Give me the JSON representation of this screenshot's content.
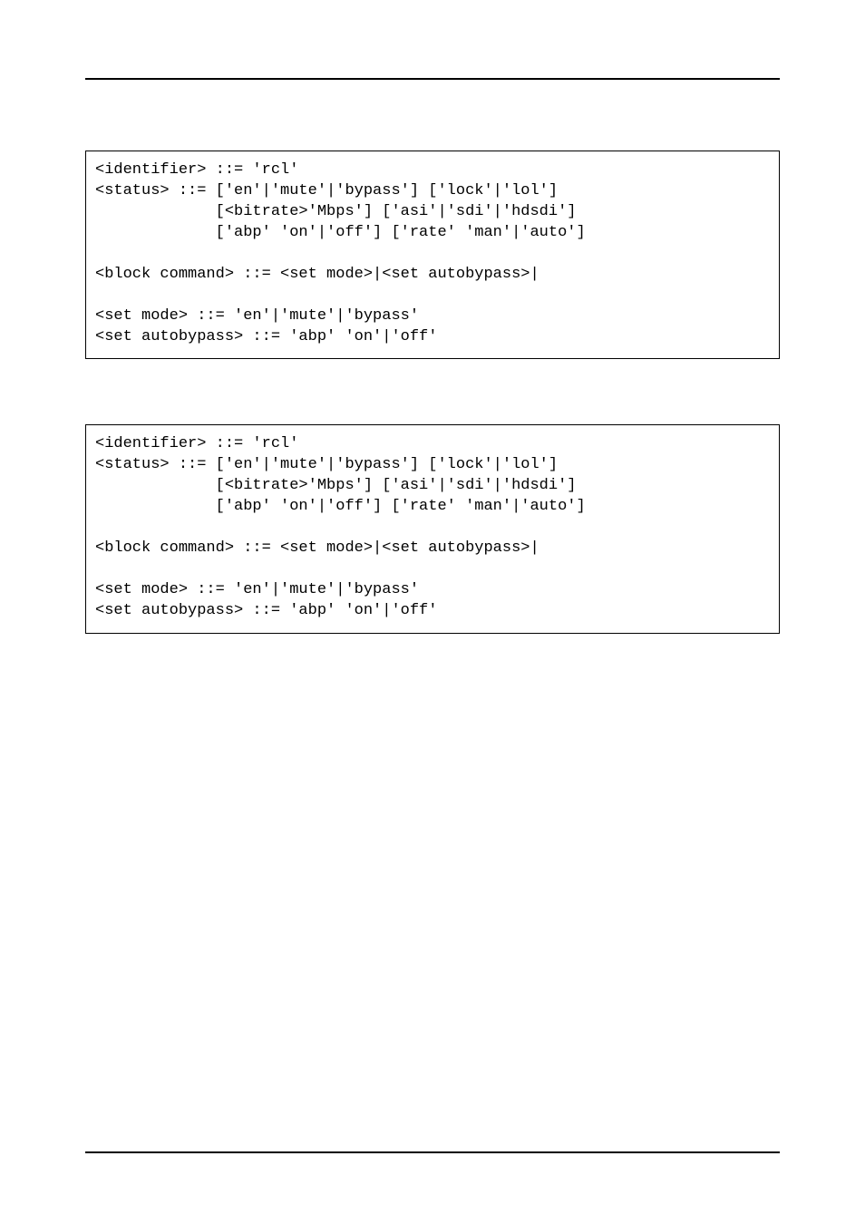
{
  "blocks": [
    {
      "lines": [
        "<identifier> ::= 'rcl'",
        "<status> ::= ['en'|'mute'|'bypass'] ['lock'|'lol']",
        "             [<bitrate>'Mbps'] ['asi'|'sdi'|'hdsdi']",
        "             ['abp' 'on'|'off'] ['rate' 'man'|'auto']",
        "",
        "<block command> ::= <set mode>|<set autobypass>|",
        "",
        "<set mode> ::= 'en'|'mute'|'bypass'",
        "<set autobypass> ::= 'abp' 'on'|'off'"
      ]
    },
    {
      "lines": [
        "<identifier> ::= 'rcl'",
        "<status> ::= ['en'|'mute'|'bypass'] ['lock'|'lol']",
        "             [<bitrate>'Mbps'] ['asi'|'sdi'|'hdsdi']",
        "             ['abp' 'on'|'off'] ['rate' 'man'|'auto']",
        "",
        "<block command> ::= <set mode>|<set autobypass>|",
        "",
        "<set mode> ::= 'en'|'mute'|'bypass'",
        "<set autobypass> ::= 'abp' 'on'|'off'"
      ]
    }
  ]
}
